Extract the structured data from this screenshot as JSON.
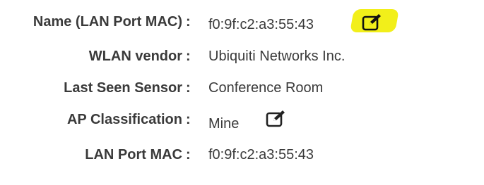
{
  "fields": [
    {
      "label": "Name (LAN Port MAC)",
      "colon": ":",
      "value": "f0:9f:c2:a3:55:43",
      "editable": true,
      "highlighted": true
    },
    {
      "label": "WLAN vendor",
      "colon": ":",
      "value": "Ubiquiti Networks Inc.",
      "editable": false
    },
    {
      "label": "Last Seen Sensor",
      "colon": ":",
      "value": "Conference Room",
      "editable": false
    },
    {
      "label": "AP Classification",
      "colon": ":",
      "value": "Mine",
      "editable": true
    },
    {
      "label": "LAN Port MAC",
      "colon": ":",
      "value": "f0:9f:c2:a3:55:43",
      "editable": false
    }
  ],
  "icons": {
    "edit": "edit-icon"
  },
  "colors": {
    "highlight": "#f2ef1a",
    "text": "#3a3a3a"
  }
}
